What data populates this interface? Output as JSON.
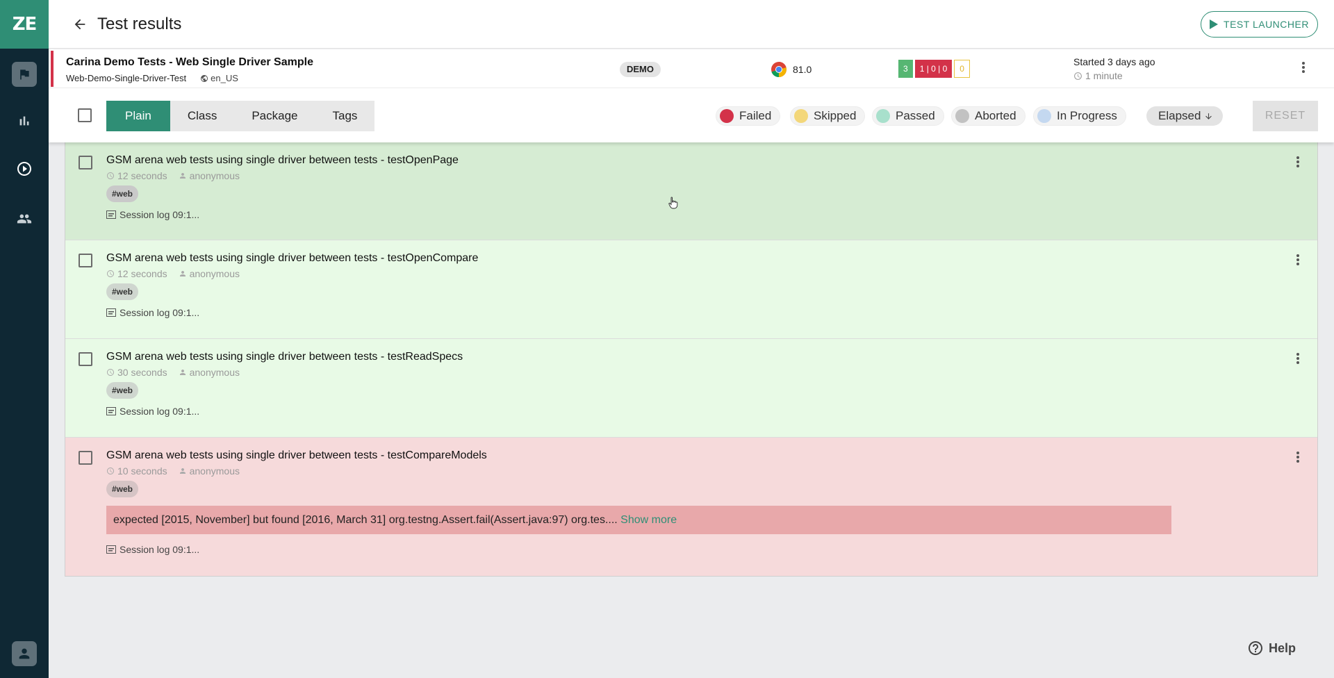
{
  "app": {
    "logo_text": "ZE",
    "accent_color": "#2f8e75"
  },
  "sidebar": {
    "items": [
      {
        "icon": "flag-icon",
        "active": true
      },
      {
        "icon": "bar-chart-icon"
      },
      {
        "icon": "play-circle-icon"
      },
      {
        "icon": "people-icon"
      },
      {
        "icon": "user-account-icon"
      }
    ]
  },
  "header": {
    "title": "Test results",
    "launcher_label": "TEST LAUNCHER"
  },
  "run": {
    "title": "Carina Demo Tests - Web Single Driver Sample",
    "job": "Web-Demo-Single-Driver-Test",
    "locale": "en_US",
    "environment": "DEMO",
    "browser_version": "81.0",
    "stats": {
      "passed": "3",
      "failed": "1 | 0 | 0",
      "skipped": "0"
    },
    "started": "Started 3 days ago",
    "elapsed": "1 minute"
  },
  "filters": {
    "tabs": [
      "Plain",
      "Class",
      "Package",
      "Tags"
    ],
    "active_tab": "Plain",
    "statuses": [
      {
        "label": "Failed",
        "color": "#d33249"
      },
      {
        "label": "Skipped",
        "color": "#f3d77a"
      },
      {
        "label": "Passed",
        "color": "#a8e0cc"
      },
      {
        "label": "Aborted",
        "color": "#c2c2c2"
      },
      {
        "label": "In Progress",
        "color": "#c4d8f0"
      }
    ],
    "sort_label": "Elapsed",
    "reset_label": "RESET"
  },
  "tests": [
    {
      "name": "GSM arena web tests using single driver between tests - testOpenPage",
      "duration": "12 seconds",
      "owner": "anonymous",
      "tag": "#web",
      "session": "Session log 09:1...",
      "status": "passed"
    },
    {
      "name": "GSM arena web tests using single driver between tests - testOpenCompare",
      "duration": "12 seconds",
      "owner": "anonymous",
      "tag": "#web",
      "session": "Session log 09:1...",
      "status": "passed"
    },
    {
      "name": "GSM arena web tests using single driver between tests - testReadSpecs",
      "duration": "30 seconds",
      "owner": "anonymous",
      "tag": "#web",
      "session": "Session log 09:1...",
      "status": "passed"
    },
    {
      "name": "GSM arena web tests using single driver between tests - testCompareModels",
      "duration": "10 seconds",
      "owner": "anonymous",
      "tag": "#web",
      "session": "Session log 09:1...",
      "status": "failed",
      "error": "expected [2015, November] but found [2016, March 31] org.testng.Assert.fail(Assert.java:97) org.tes....",
      "show_more": "Show more"
    }
  ],
  "help_label": "Help"
}
